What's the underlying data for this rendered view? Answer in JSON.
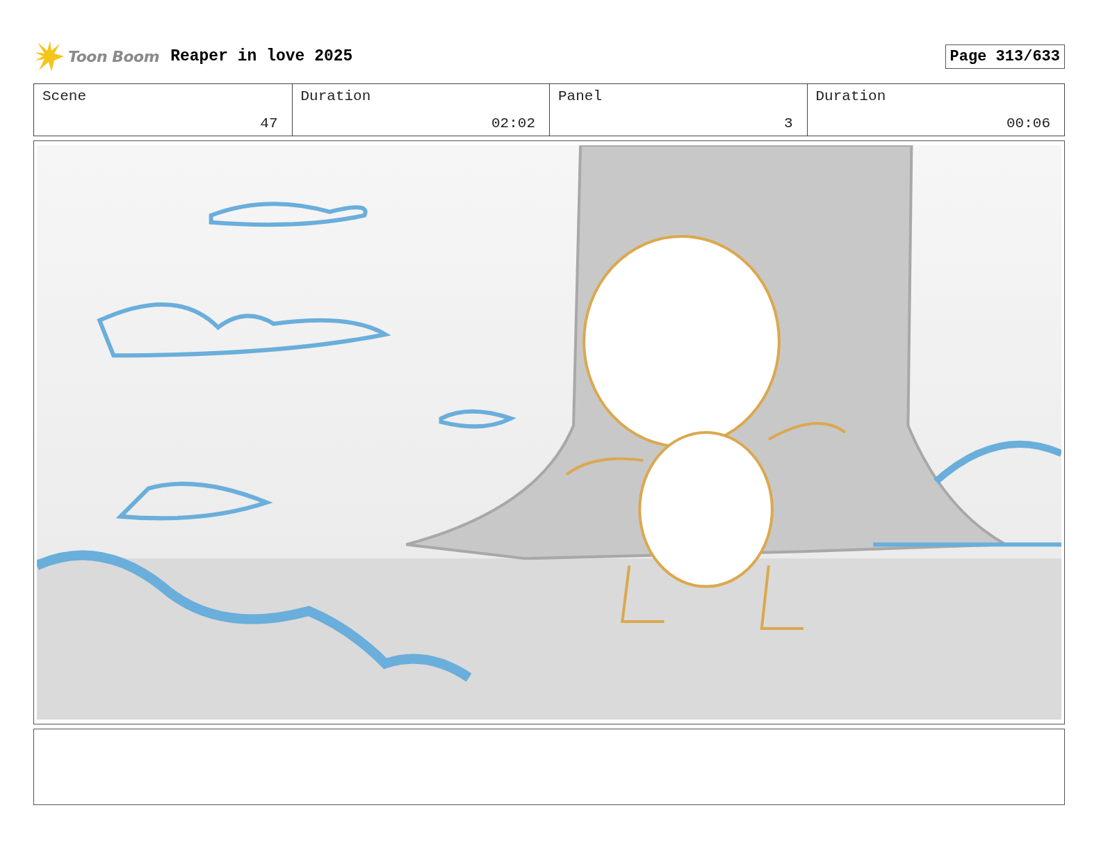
{
  "header": {
    "logo": "Toon Boom",
    "title": "Reaper in love 2025",
    "page": "Page 313/633"
  },
  "info": [
    {
      "label": "Scene",
      "value": "47"
    },
    {
      "label": "Duration",
      "value": "02:02"
    },
    {
      "label": "Panel",
      "value": "3"
    },
    {
      "label": "Duration",
      "value": "00:06"
    }
  ]
}
